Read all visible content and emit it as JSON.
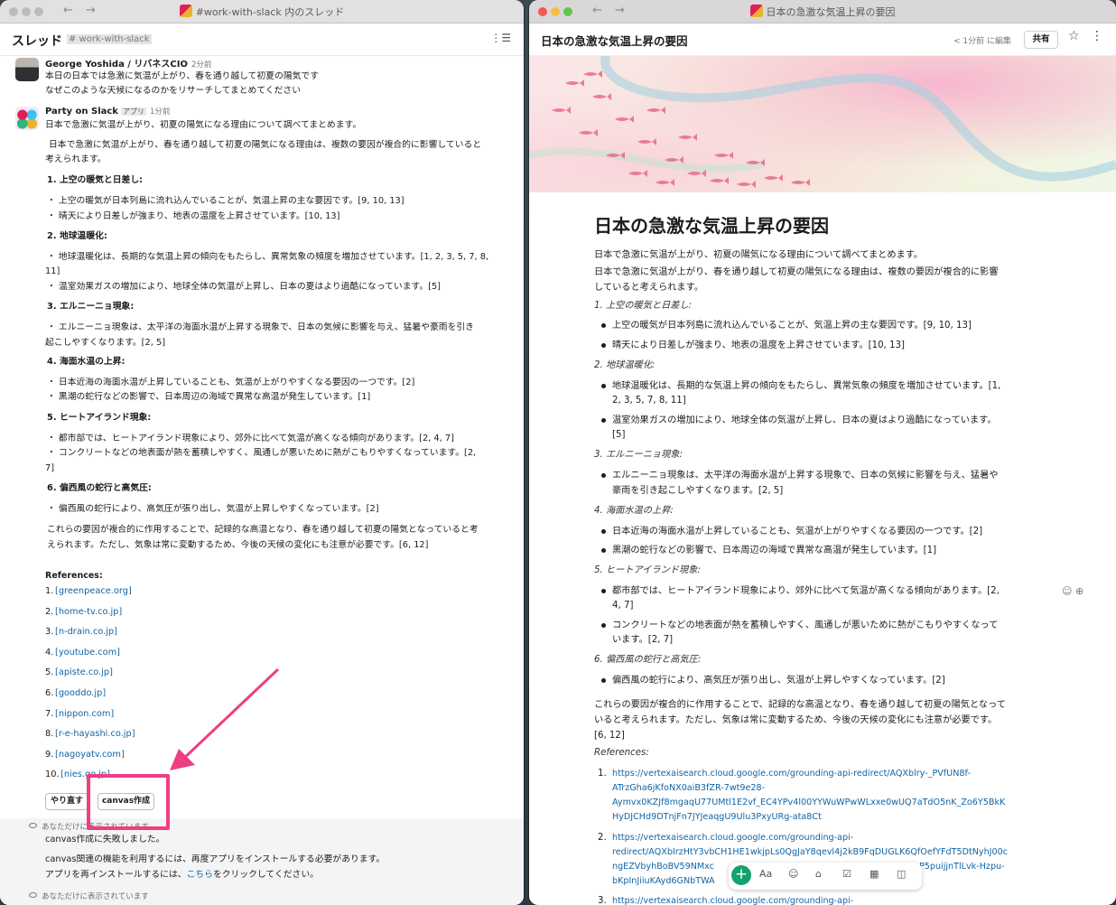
{
  "left_window": {
    "title": "#work-with-slack 内のスレッド",
    "thread_title": "スレッド",
    "channel": "# work-with-slack",
    "messages": {
      "user": {
        "name": "George Yoshida / リバネスCIO",
        "time": "2分前",
        "line1": "本日の日本では急激に気温が上がり、春を通り越して初夏の陽気です",
        "line2": "なぜこのような天候になるのかをリサーチしてまとめてください"
      },
      "bot": {
        "name": "Party on Slack",
        "badge": "アプリ",
        "time": "1分前",
        "intro": "日本で急激に気温が上がり、初夏の陽気になる理由について調べてまとめます。",
        "para1a": "日本で急激に気温が上がり、春を通り越して初夏の陽気になる理由は、複数の要因が複合的に影響していると",
        "para1b": "考えられます。",
        "s1": "1. 上空の暖気と日差し:",
        "s1a": "・ 上空の暖気が日本列島に流れ込んでいることが、気温上昇の主な要因です。[9, 10, 13]",
        "s1b": "・ 晴天により日差しが強まり、地表の温度を上昇させています。[10, 13]",
        "s2": "2. 地球温暖化:",
        "s2a1": "・ 地球温暖化は、長期的な気温上昇の傾向をもたらし、異常気象の頻度を増加させています。[1, 2, 3, 5, 7, 8,",
        "s2a2": "11]",
        "s2b": "・ 温室効果ガスの増加により、地球全体の気温が上昇し、日本の夏はより過酷になっています。[5]",
        "s3": "3. エルニーニョ現象:",
        "s3a1": "・ エルニーニョ現象は、太平洋の海面水温が上昇する現象で、日本の気候に影響を与え、猛暑や豪雨を引き",
        "s3a2": "起こしやすくなります。[2, 5]",
        "s4": "4. 海面水温の上昇:",
        "s4a": "・ 日本近海の海面水温が上昇していることも、気温が上がりやすくなる要因の一つです。[2]",
        "s4b": "・ 黒潮の蛇行などの影響で、日本周辺の海域で異常な高温が発生しています。[1]",
        "s5": "5. ヒートアイランド現象:",
        "s5a": "・ 都市部では、ヒートアイランド現象により、郊外に比べて気温が高くなる傾向があります。[2, 4, 7]",
        "s5b1": "・ コンクリートなどの地表面が熱を蓄積しやすく、風通しが悪いために熱がこもりやすくなっています。[2,",
        "s5b2": "7]",
        "s6": "6. 偏西風の蛇行と高気圧:",
        "s6a": "・ 偏西風の蛇行により、高気圧が張り出し、気温が上昇しやすくなっています。[2]",
        "concl1": "これらの要因が複合的に作用することで、記録的な高温となり、春を通り越して初夏の陽気となっていると考",
        "concl2": "えられます。ただし、気象は常に変動するため、今後の天候の変化にも注意が必要です。[6, 12]",
        "refs_label": "References:",
        "refs": [
          {
            "num": "1.",
            "text": "[greenpeace.org]"
          },
          {
            "num": "2.",
            "text": "[home-tv.co.jp]"
          },
          {
            "num": "3.",
            "text": "[n-drain.co.jp]"
          },
          {
            "num": "4.",
            "text": "[youtube.com]"
          },
          {
            "num": "5.",
            "text": "[apiste.co.jp]"
          },
          {
            "num": "6.",
            "text": "[gooddo.jp]"
          },
          {
            "num": "7.",
            "text": "[nippon.com]"
          },
          {
            "num": "8.",
            "text": "[r-e-hayashi.co.jp]"
          },
          {
            "num": "9.",
            "text": "[nagoyatv.com]"
          },
          {
            "num": "10.",
            "text": "[nies.go.jp]"
          }
        ],
        "retry_button": "やり直す",
        "canvas_button": "canvas作成"
      },
      "ephemeral": {
        "note": "あなただけに表示されています",
        "fail": "canvas作成に失敗しました。",
        "reinstall1": "canvas関連の機能を利用するには、再度アプリをインストールする必要があります。",
        "reinstall2_prefix": "アプリを再インストールするには、",
        "reinstall2_link": "こちら",
        "reinstall2_suffix": "をクリックしてください。",
        "note2": "あなただけに表示されています"
      }
    }
  },
  "right_window": {
    "title": "日本の急激な気温上昇の要因",
    "header_title": "日本の急激な気温上昇の要因",
    "edited": "< 1分前 に編集",
    "share": "共有",
    "doc": {
      "title": "日本の急激な気温上昇の要因",
      "p1": "日本で急激に気温が上がり、初夏の陽気になる理由について調べてまとめます。",
      "p2a": "日本で急激に気温が上がり、春を通り越して初夏の陽気になる理由は、複数の要因が複合的に影響",
      "p2b": "していると考えられます。",
      "h1": "1. 上空の暖気と日差し:",
      "b1a": "上空の暖気が日本列島に流れ込んでいることが、気温上昇の主な要因です。[9, 10, 13]",
      "b1b": "晴天により日差しが強まり、地表の温度を上昇させています。[10, 13]",
      "h2": "2. 地球温暖化:",
      "b2a1": "地球温暖化は、長期的な気温上昇の傾向をもたらし、異常気象の頻度を増加させています。[1,",
      "b2a2": "2, 3, 5, 7, 8, 11]",
      "b2b1": "温室効果ガスの増加により、地球全体の気温が上昇し、日本の夏はより過酷になっています。",
      "b2b2": "[5]",
      "h3": "3. エルニーニョ現象:",
      "b3a1": "エルニーニョ現象は、太平洋の海面水温が上昇する現象で、日本の気候に影響を与え、猛暑や",
      "b3a2": "豪雨を引き起こしやすくなります。[2, 5]",
      "h4": "4. 海面水温の上昇:",
      "b4a": "日本近海の海面水温が上昇していることも、気温が上がりやすくなる要因の一つです。[2]",
      "b4b": "黒潮の蛇行などの影響で、日本周辺の海域で異常な高温が発生しています。[1]",
      "h5": "5. ヒートアイランド現象:",
      "b5a1": "都市部では、ヒートアイランド現象により、郊外に比べて気温が高くなる傾向があります。[2,",
      "b5a2": "4, 7]",
      "b5b1": "コンクリートなどの地表面が熱を蓄積しやすく、風通しが悪いために熱がこもりやすくなって",
      "b5b2": "います。[2, 7]",
      "h6": "6. 偏西風の蛇行と高気圧:",
      "b6a": "偏西風の蛇行により、高気圧が張り出し、気温が上昇しやすくなっています。[2]",
      "c1": "これらの要因が複合的に作用することで、記録的な高温となり、春を通り越して初夏の陽気となって",
      "c2": "いると考えられます。ただし、気象は常に変動するため、今後の天候の変化にも注意が必要です。",
      "c3": "[6, 12]",
      "refs_label": "References:",
      "r1_num": "1.",
      "r1a": "https://vertexaisearch.cloud.google.com/grounding-api-redirect/AQXblry-_PVfUN8f-",
      "r1b": "ATrzGha6jKfoNX0aiB3fZR-7wt9e28-",
      "r1c": "Aymvx0KZJf8mgaqU77UMtl1E2vf_EC4YPv4l00YYWuWPwWLxxe0wUQ7aTdO5nK_Zo6Y5BkK",
      "r1d": "HyDJCHd9DTnjFn7JYJeaqgU9Ulu3PxyURg-ata8Ct",
      "r2_num": "2.",
      "r2a": "https://vertexaisearch.cloud.google.com/grounding-api-",
      "r2b": "redirect/AQXbIrzHtY3vbCH1HE1wkjpLs0QgJaY8qevl4j2kB9FqDUGLK6QfOefYFdT5DtNyhJ00c",
      "r2c": "ngEZVbyhBoBV59NMxc",
      "r2c_tail": "P5puijjnTlLvk-Hzpu-",
      "r2d": "bKpInJiiuKAyd6GNbTWA",
      "r3_num": "3.",
      "r3a": "https://vertexaisearch.cloud.google.com/grounding-api-"
    },
    "toolbar": {
      "plus": "+",
      "text_format": "Aa",
      "emoji": "☺",
      "attach": "⌂",
      "check": "☑",
      "table": "▦",
      "split": "◫"
    }
  }
}
